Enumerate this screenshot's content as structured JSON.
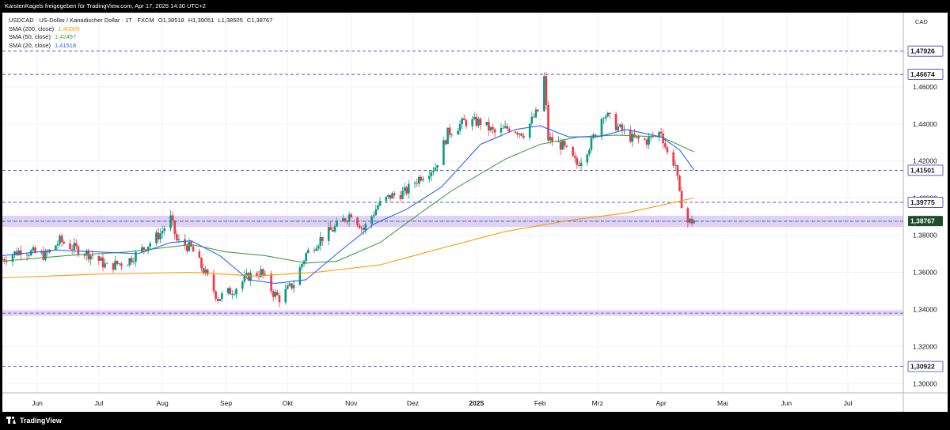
{
  "header": {
    "attribution": "KarstenKagels freigegeben für TradingView.com, Apr 17, 2025 14:30 UTC+2"
  },
  "footer": {
    "logo_text": "TradingView"
  },
  "legend": {
    "symbol_line": "USDCAD · US-Dollar / Kanadischer Dollar · 1T · FXCM",
    "ohlc": {
      "o_label": "O",
      "o": "1,38518",
      "h_label": "H",
      "h": "1,39051",
      "l_label": "L",
      "l": "1,38505",
      "c_label": "C",
      "c": "1,38767"
    },
    "sma": [
      {
        "label": "SMA (200, close)",
        "value": "1,40009",
        "color": "#ff9800"
      },
      {
        "label": "SMA (50, close)",
        "value": "1,42497",
        "color": "#43a047"
      },
      {
        "label": "SMA (20, close)",
        "value": "1,41518",
        "color": "#2962ff"
      }
    ]
  },
  "colors": {
    "up": "#089981",
    "down": "#f23645",
    "sma200": "#ff9800",
    "sma50": "#43a047",
    "sma20": "#2962ff",
    "level_line": "#3f3fbf",
    "zone_fill": "#d8c7f2",
    "current_price_box": "#1e4d2b"
  },
  "chart_data": {
    "type": "candlestick",
    "symbol": "USDCAD",
    "currency": "CAD",
    "ylim": [
      1.295,
      1.5
    ],
    "y_ticks": [
      "1,30000",
      "1,32000",
      "1,34000",
      "1,36000",
      "1,38000",
      "1,40000",
      "1,42000",
      "1,44000",
      "1,46000"
    ],
    "y_tick_values": [
      1.3,
      1.32,
      1.34,
      1.36,
      1.38,
      1.4,
      1.42,
      1.44,
      1.46
    ],
    "x_ticks": [
      {
        "label": "Jun",
        "date": "2024-06-01"
      },
      {
        "label": "Jul",
        "date": "2024-07-01"
      },
      {
        "label": "Aug",
        "date": "2024-08-01"
      },
      {
        "label": "Sep",
        "date": "2024-09-01"
      },
      {
        "label": "Okt",
        "date": "2024-10-01"
      },
      {
        "label": "Nov",
        "date": "2024-11-01"
      },
      {
        "label": "Dez",
        "date": "2024-12-01"
      },
      {
        "label": "2025",
        "date": "2025-01-01",
        "bold": true
      },
      {
        "label": "Feb",
        "date": "2025-02-01"
      },
      {
        "label": "Mrz",
        "date": "2025-03-01"
      },
      {
        "label": "Apr",
        "date": "2025-04-01"
      },
      {
        "label": "Mai",
        "date": "2025-05-01"
      },
      {
        "label": "Jun",
        "date": "2025-06-01"
      },
      {
        "label": "Jul",
        "date": "2025-07-01"
      }
    ],
    "x_range": [
      "2024-05-15",
      "2025-07-28"
    ],
    "horizontal_levels": [
      {
        "value": 1.47926,
        "label": "1,47926"
      },
      {
        "value": 1.46674,
        "label": "1,46674"
      },
      {
        "value": 1.41501,
        "label": "1,41501"
      },
      {
        "value": 1.39775,
        "label": "1,39775"
      },
      {
        "value": 1.30922,
        "label": "1,30922"
      }
    ],
    "zones": [
      {
        "from": 1.3845,
        "to": 1.3905
      },
      {
        "from": 1.3365,
        "to": 1.3395
      }
    ],
    "current_price": {
      "value": 1.38767,
      "label": "1,38767"
    },
    "price_path": [
      [
        "2024-05-15",
        1.367
      ],
      [
        "2024-05-24",
        1.372
      ],
      [
        "2024-06-05",
        1.369
      ],
      [
        "2024-06-12",
        1.377
      ],
      [
        "2024-06-19",
        1.373
      ],
      [
        "2024-06-28",
        1.369
      ],
      [
        "2024-07-05",
        1.363
      ],
      [
        "2024-07-15",
        1.366
      ],
      [
        "2024-07-24",
        1.374
      ],
      [
        "2024-07-31",
        1.381
      ],
      [
        "2024-08-05",
        1.389
      ],
      [
        "2024-08-08",
        1.377
      ],
      [
        "2024-08-15",
        1.373
      ],
      [
        "2024-08-22",
        1.359
      ],
      [
        "2024-08-28",
        1.346
      ],
      [
        "2024-09-05",
        1.351
      ],
      [
        "2024-09-12",
        1.358
      ],
      [
        "2024-09-18",
        1.36
      ],
      [
        "2024-09-24",
        1.349
      ],
      [
        "2024-09-27",
        1.346
      ],
      [
        "2024-10-04",
        1.354
      ],
      [
        "2024-10-10",
        1.37
      ],
      [
        "2024-10-17",
        1.378
      ],
      [
        "2024-10-24",
        1.384
      ],
      [
        "2024-11-01",
        1.392
      ],
      [
        "2024-11-07",
        1.383
      ],
      [
        "2024-11-14",
        1.396
      ],
      [
        "2024-11-20",
        1.401
      ],
      [
        "2024-11-27",
        1.403
      ],
      [
        "2024-12-05",
        1.412
      ],
      [
        "2024-12-12",
        1.417
      ],
      [
        "2024-12-18",
        1.435
      ],
      [
        "2024-12-26",
        1.441
      ],
      [
        "2025-01-03",
        1.441
      ],
      [
        "2025-01-10",
        1.435
      ],
      [
        "2025-01-17",
        1.438
      ],
      [
        "2025-01-24",
        1.435
      ],
      [
        "2025-01-31",
        1.447
      ],
      [
        "2025-02-03",
        1.465
      ],
      [
        "2025-02-05",
        1.432
      ],
      [
        "2025-02-12",
        1.428
      ],
      [
        "2025-02-19",
        1.418
      ],
      [
        "2025-02-26",
        1.43
      ],
      [
        "2025-03-04",
        1.446
      ],
      [
        "2025-03-11",
        1.438
      ],
      [
        "2025-03-18",
        1.432
      ],
      [
        "2025-03-25",
        1.431
      ],
      [
        "2025-04-01",
        1.436
      ],
      [
        "2025-04-04",
        1.424
      ],
      [
        "2025-04-08",
        1.418
      ],
      [
        "2025-04-10",
        1.401
      ],
      [
        "2025-04-14",
        1.387
      ],
      [
        "2025-04-17",
        1.388
      ]
    ],
    "sma200_path": [
      [
        "2024-05-15",
        1.357
      ],
      [
        "2024-07-01",
        1.359
      ],
      [
        "2024-08-15",
        1.36
      ],
      [
        "2024-09-15",
        1.358
      ],
      [
        "2024-10-15",
        1.36
      ],
      [
        "2024-11-15",
        1.364
      ],
      [
        "2024-12-15",
        1.373
      ],
      [
        "2025-01-15",
        1.382
      ],
      [
        "2025-02-15",
        1.388
      ],
      [
        "2025-03-15",
        1.392
      ],
      [
        "2025-04-17",
        1.40009
      ]
    ],
    "sma50_path": [
      [
        "2024-05-15",
        1.366
      ],
      [
        "2024-06-15",
        1.369
      ],
      [
        "2024-07-15",
        1.371
      ],
      [
        "2024-08-15",
        1.375
      ],
      [
        "2024-09-01",
        1.371
      ],
      [
        "2024-09-20",
        1.369
      ],
      [
        "2024-10-10",
        1.365
      ],
      [
        "2024-10-25",
        1.366
      ],
      [
        "2024-11-15",
        1.376
      ],
      [
        "2024-12-01",
        1.389
      ],
      [
        "2024-12-20",
        1.404
      ],
      [
        "2025-01-15",
        1.421
      ],
      [
        "2025-02-01",
        1.429
      ],
      [
        "2025-02-20",
        1.433
      ],
      [
        "2025-03-10",
        1.434
      ],
      [
        "2025-04-01",
        1.433
      ],
      [
        "2025-04-17",
        1.42497
      ]
    ],
    "sma20_path": [
      [
        "2024-05-15",
        1.369
      ],
      [
        "2024-06-10",
        1.372
      ],
      [
        "2024-07-01",
        1.371
      ],
      [
        "2024-07-20",
        1.37
      ],
      [
        "2024-08-05",
        1.376
      ],
      [
        "2024-08-15",
        1.377
      ],
      [
        "2024-08-29",
        1.369
      ],
      [
        "2024-09-12",
        1.356
      ],
      [
        "2024-09-25",
        1.354
      ],
      [
        "2024-10-10",
        1.356
      ],
      [
        "2024-10-25",
        1.37
      ],
      [
        "2024-11-12",
        1.386
      ],
      [
        "2024-11-28",
        1.394
      ],
      [
        "2024-12-15",
        1.406
      ],
      [
        "2025-01-03",
        1.429
      ],
      [
        "2025-01-20",
        1.437
      ],
      [
        "2025-02-01",
        1.439
      ],
      [
        "2025-02-15",
        1.433
      ],
      [
        "2025-03-01",
        1.433
      ],
      [
        "2025-03-15",
        1.437
      ],
      [
        "2025-04-01",
        1.433
      ],
      [
        "2025-04-10",
        1.426
      ],
      [
        "2025-04-17",
        1.41518
      ]
    ]
  }
}
